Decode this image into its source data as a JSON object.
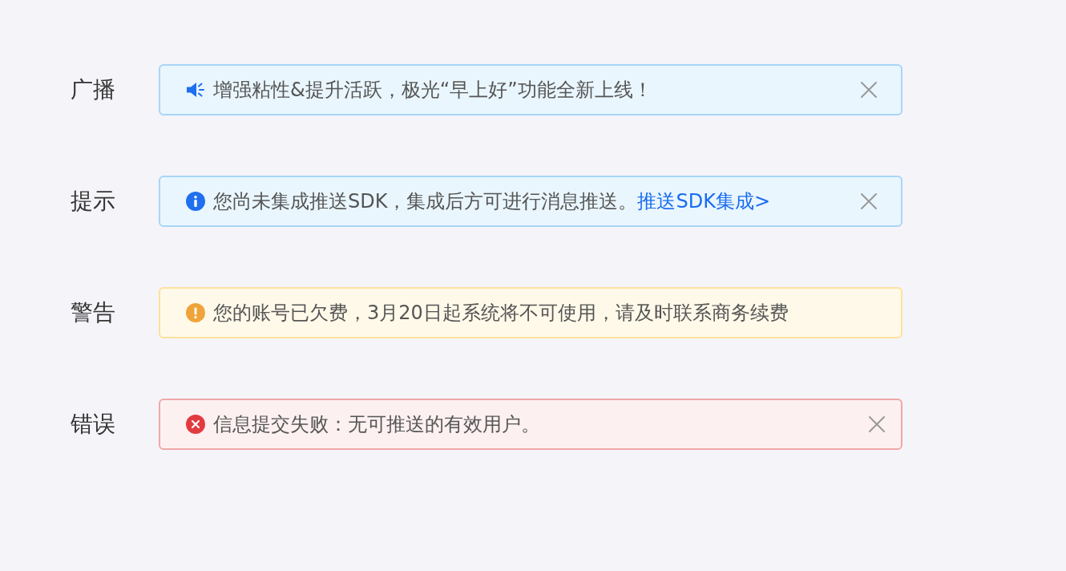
{
  "alerts": [
    {
      "label": "广播",
      "kind": "broadcast",
      "message": "增强粘性&提升活跃，极光“早上好”功能全新上线！",
      "closable": true
    },
    {
      "label": "提示",
      "kind": "info",
      "message": "您尚未集成推送SDK，集成后方可进行消息推送。",
      "link": "推送SDK集成>",
      "closable": true
    },
    {
      "label": "警告",
      "kind": "warning",
      "message": "您的账号已欠费，3月20日起系统将不可使用，请及时联系商务续费",
      "closable": false
    },
    {
      "label": "错误",
      "kind": "error",
      "message": "信息提交失败：无可推送的有效用户。",
      "closable": true
    }
  ]
}
